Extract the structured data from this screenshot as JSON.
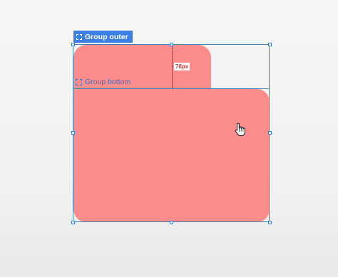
{
  "layers": {
    "outer_label": "Group outer",
    "bottom_label": "Group bottom"
  },
  "measure": {
    "label": "78px"
  },
  "colors": {
    "shape_fill": "#fd8c8d",
    "selection": "#3b7fe4",
    "measure": "#d63434",
    "label_text": "#3d72c4"
  },
  "icons": {
    "group": "dashed-group-icon",
    "cursor": "hand-pointer-icon"
  }
}
